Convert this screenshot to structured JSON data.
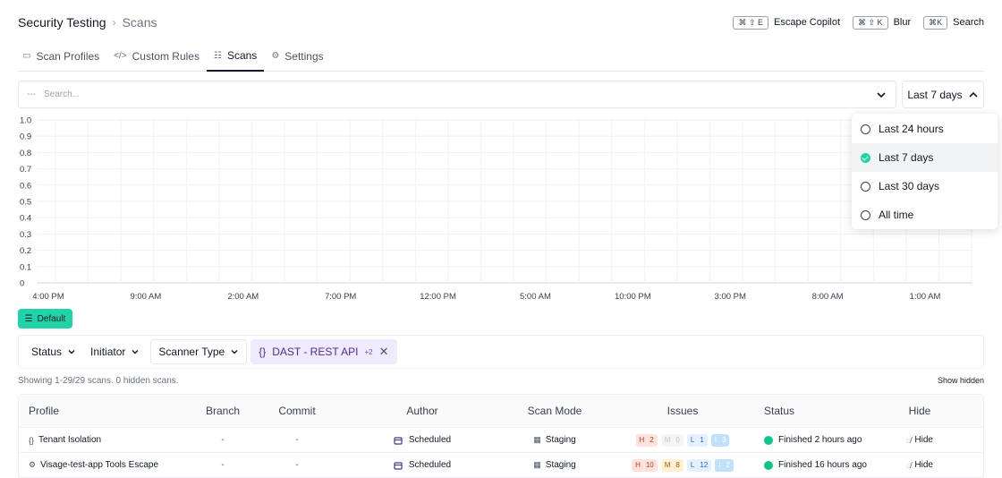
{
  "breadcrumb": {
    "root": "Security Testing",
    "leaf": "Scans"
  },
  "shortcuts": [
    {
      "keys": "⌘ ⇧ E",
      "label": "Escape Copilot"
    },
    {
      "keys": "⌘ ⇧ K",
      "label": "Blur"
    },
    {
      "keys": "⌘K",
      "label": "Search"
    }
  ],
  "tabs": [
    {
      "label": "Scan Profiles",
      "icon": "card-icon",
      "glyph": "▭"
    },
    {
      "label": "Custom Rules",
      "icon": "code-icon",
      "glyph": "</>"
    },
    {
      "label": "Scans",
      "icon": "list-icon",
      "glyph": "☷"
    },
    {
      "label": "Settings",
      "icon": "gear-icon",
      "glyph": "⚙"
    }
  ],
  "search": {
    "prefix": "---",
    "placeholder": "Search..."
  },
  "range": {
    "selected": "Last 7 days",
    "options": [
      "Last 24 hours",
      "Last 7 days",
      "Last 30 days",
      "All time"
    ]
  },
  "chart_data": {
    "type": "bar",
    "ylim": [
      0,
      1.0
    ],
    "yticks": [
      "1.0",
      "0.9",
      "0.8",
      "0.7",
      "0.6",
      "0.5",
      "0.4",
      "0.3",
      "0.2",
      "0.1",
      "0"
    ],
    "xticks": [
      "4:00 PM",
      "9:00 AM",
      "2:00 AM",
      "7:00 PM",
      "12:00 PM",
      "5:00 AM",
      "10:00 PM",
      "3:00 PM",
      "8:00 AM",
      "1:00 AM"
    ],
    "grid": true,
    "bar_color": "#21d4a7",
    "values": [
      0,
      0,
      0,
      0,
      0,
      0,
      0,
      0,
      0,
      0,
      0,
      0,
      0,
      0,
      0,
      0,
      0,
      0,
      0,
      0,
      0,
      0,
      0,
      0,
      0,
      0,
      0,
      0,
      0
    ]
  },
  "view": {
    "label": "Default"
  },
  "filters": {
    "status": "Status",
    "initiator": "Initiator",
    "scanner_type": "Scanner Type",
    "active_tag": {
      "label": "DAST - REST API",
      "extra": "+2",
      "glyph": "{}"
    }
  },
  "summary": {
    "showing": "Showing 1-29/29 scans. 0 hidden scans.",
    "show_hidden": "Show hidden"
  },
  "table": {
    "headers": {
      "profile": "Profile",
      "branch": "Branch",
      "commit": "Commit",
      "author": "Author",
      "mode": "Scan Mode",
      "issues": "Issues",
      "status": "Status",
      "hide": "Hide"
    },
    "rows": [
      {
        "profile": "Tenant Isolation",
        "profile_glyph": "{}",
        "branch": "-",
        "commit": "-",
        "author": "Scheduled",
        "mode": "Staging",
        "issues": {
          "h_label": "H",
          "h": "2",
          "m_label": "M",
          "m": "0",
          "l_label": "L",
          "l": "1",
          "i_label": "I",
          "i": "3"
        },
        "status": "Finished 2 hours ago",
        "hide": "Hide"
      },
      {
        "profile": "Visage-test-app Tools Escape",
        "profile_glyph": "⚙",
        "branch": "-",
        "commit": "-",
        "author": "Scheduled",
        "mode": "Staging",
        "issues": {
          "h_label": "H",
          "h": "10",
          "m_label": "M",
          "m": "8",
          "l_label": "L",
          "l": "12",
          "i_label": "I",
          "i": "2"
        },
        "status": "Finished 16 hours ago",
        "hide": "Hide"
      }
    ]
  }
}
